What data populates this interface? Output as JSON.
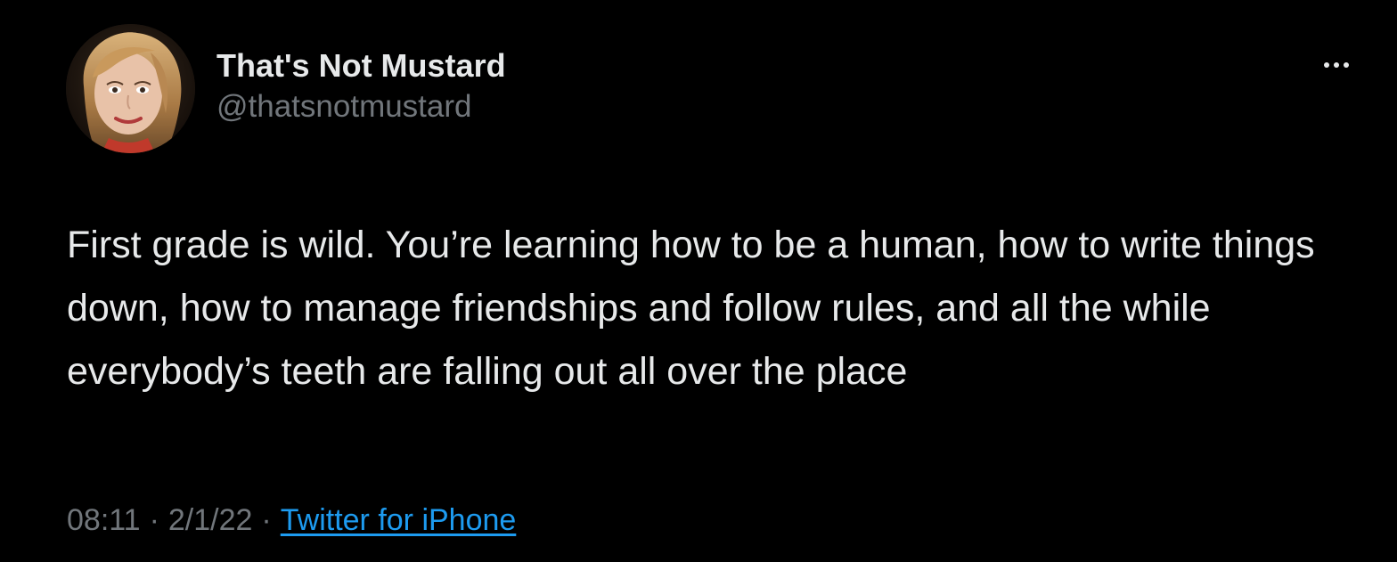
{
  "tweet": {
    "author": {
      "display_name": "That's Not Mustard",
      "handle": "@thatsnotmustard"
    },
    "text": "First grade is wild. You’re learning how to be a human, how to write things down, how to manage friendships and follow rules, and all the while everybody’s teeth are falling out all over the place",
    "meta": {
      "time": "08:11",
      "separator": "·",
      "date": "2/1/22",
      "source": "Twitter for iPhone"
    }
  },
  "icons": {
    "more": "more-options-icon"
  },
  "colors": {
    "background": "#000000",
    "text_primary": "#e7e9ea",
    "text_secondary": "#71767b",
    "link": "#1d9bf0"
  }
}
